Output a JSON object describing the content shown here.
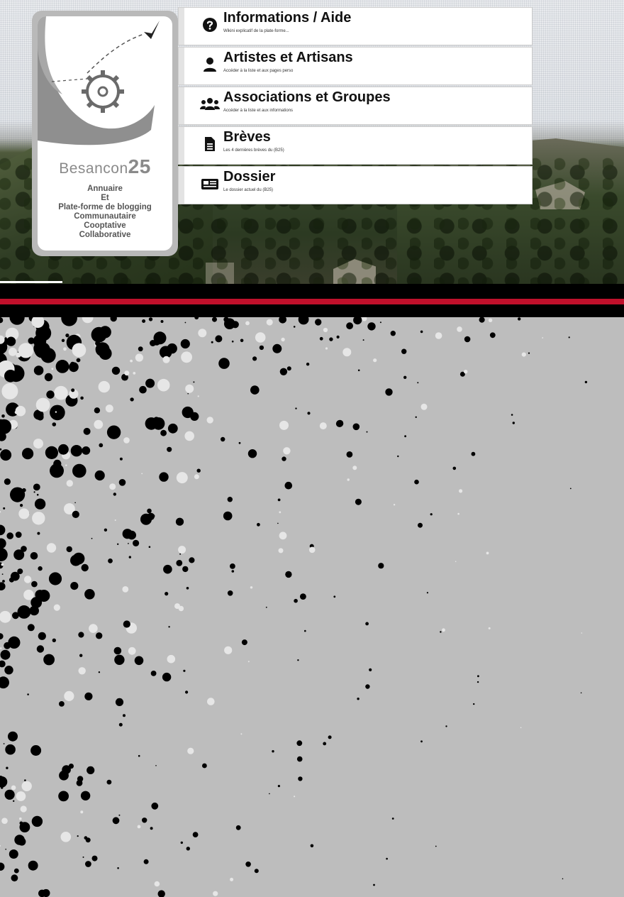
{
  "logo": {
    "name": "Besancon",
    "number": "25",
    "lines": [
      "Annuaire",
      "Et",
      "Plate-forme de blogging",
      "Communautaire",
      "Cooptative",
      "Collaborative"
    ]
  },
  "menu": {
    "items": [
      {
        "title": "Informations / Aide",
        "subtitle": "Wikini explicatif de la plate-forme...",
        "icon": "question-circle-icon"
      },
      {
        "title": "Artistes et Artisans",
        "subtitle": "Accéder à la liste et aux pages perso",
        "icon": "user-icon"
      },
      {
        "title": "Associations et Groupes",
        "subtitle": "Accéder à la liste et aux informations",
        "icon": "users-icon"
      },
      {
        "title": "Brèves",
        "subtitle": "Les 4 dernières brèves du (B25)",
        "icon": "document-icon"
      },
      {
        "title": "Dossier",
        "subtitle": "Le dossier actuel du (B25)",
        "icon": "newspaper-icon"
      }
    ]
  },
  "colors": {
    "accent_red": "#c0102b",
    "bar_black": "#000000",
    "background_grey": "#bdbdbd"
  }
}
